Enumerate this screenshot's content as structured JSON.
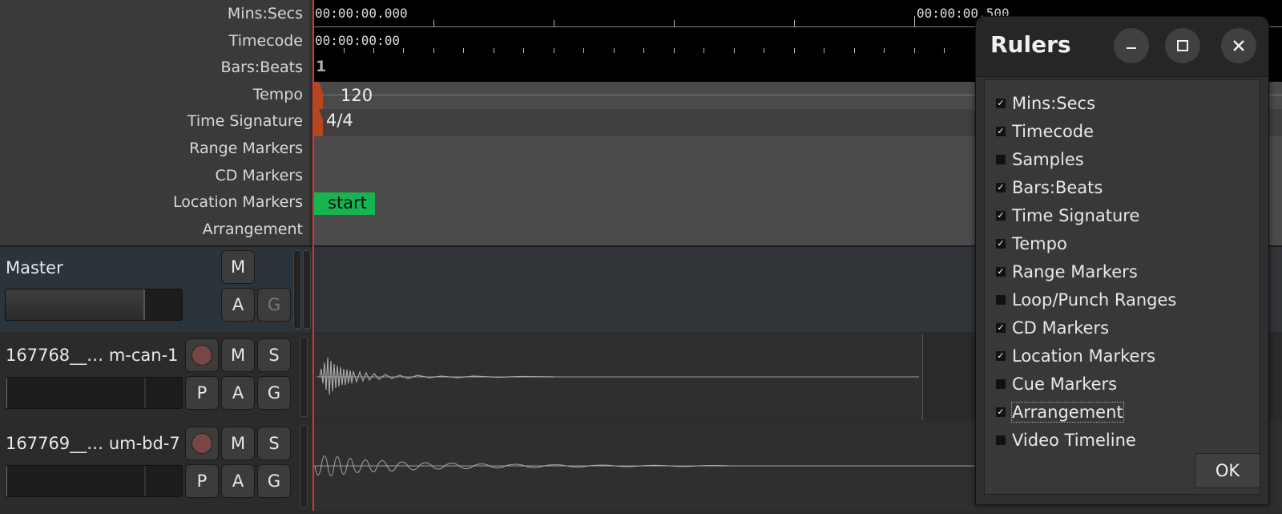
{
  "rulers": {
    "labels": [
      "Mins:Secs",
      "Timecode",
      "Bars:Beats",
      "Tempo",
      "Time Signature",
      "Range Markers",
      "CD Markers",
      "Location Markers",
      "Arrangement"
    ],
    "minsecs_start": "00:00:00.000",
    "minsecs_mid": "00:00:00.500",
    "timecode_start": "00:00:00:00",
    "bars_start": "1",
    "tempo_value": "120",
    "time_signature": "4/4",
    "location_marker": "start"
  },
  "tracks": [
    {
      "name": "Master",
      "buttons_top": [
        "M"
      ],
      "buttons_bottom": [
        "A",
        "G"
      ],
      "fader_level": 0.78
    },
    {
      "name": "167768__… m-can-1",
      "buttons_top": [
        "M",
        "S"
      ],
      "buttons_bottom": [
        "P",
        "A",
        "G"
      ],
      "fader_level": 0.0
    },
    {
      "name": "167769__… um-bd-7",
      "buttons_top": [
        "M",
        "S"
      ],
      "buttons_bottom": [
        "P",
        "A",
        "G"
      ],
      "fader_level": 0.0
    }
  ],
  "dialog": {
    "title": "Rulers",
    "options": [
      {
        "label": "Mins:Secs",
        "checked": true
      },
      {
        "label": "Timecode",
        "checked": true
      },
      {
        "label": "Samples",
        "checked": false
      },
      {
        "label": "Bars:Beats",
        "checked": true
      },
      {
        "label": "Time Signature",
        "checked": true
      },
      {
        "label": "Tempo",
        "checked": true
      },
      {
        "label": "Range Markers",
        "checked": true
      },
      {
        "label": "Loop/Punch Ranges",
        "checked": false
      },
      {
        "label": "CD Markers",
        "checked": true
      },
      {
        "label": "Location Markers",
        "checked": true
      },
      {
        "label": "Cue Markers",
        "checked": false
      },
      {
        "label": "Arrangement",
        "checked": true
      },
      {
        "label": "Video Timeline",
        "checked": false
      }
    ],
    "ok_label": "OK"
  },
  "colors": {
    "playhead": "#e0303a",
    "location_marker": "#17b34f",
    "tempo_marker": "#b5461e"
  }
}
